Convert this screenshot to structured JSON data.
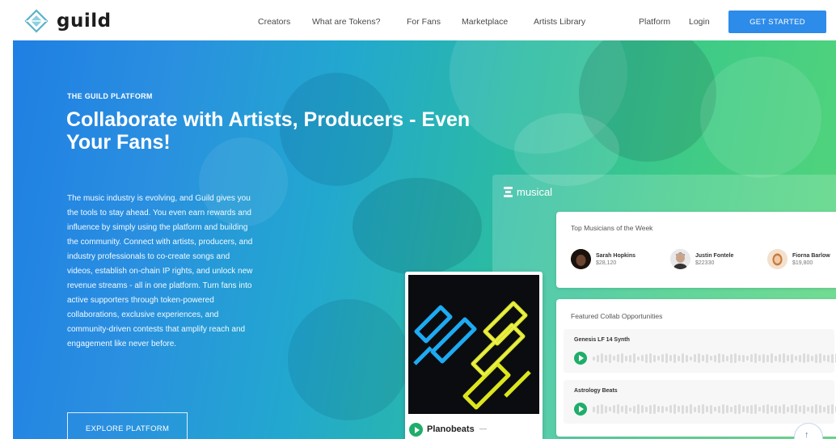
{
  "header": {
    "logo_text": "guild",
    "nav": [
      {
        "label": "Creators"
      },
      {
        "label": "What are Tokens?"
      },
      {
        "label": "For Fans"
      },
      {
        "label": "Marketplace"
      },
      {
        "label": "Artists Library"
      },
      {
        "label": "Platform"
      },
      {
        "label": "Login"
      }
    ],
    "cta_label": "GET STARTED"
  },
  "hero": {
    "eyebrow": "THE GUILD PLATFORM",
    "headline": "Collaborate with Artists, Producers - Even Your Fans!",
    "description": "The music industry is evolving, and Guild gives you the tools to stay ahead. You even earn rewards and influence by simply using the platform and building the community. Connect with artists, producers, and industry professionals to co-create songs and videos, establish on-chain IP rights, and unlock new revenue streams - all in one platform. Turn fans into active supporters through token-powered collaborations, exclusive experiences, and community-driven contests that amplify reach and engagement like never before.",
    "explore_label": "EXPLORE PLATFORM"
  },
  "panel": {
    "brand": "musical",
    "top_title": "Top Musicians of the Week",
    "musicians": [
      {
        "name": "Sarah Hopkins",
        "value": "$28,120"
      },
      {
        "name": "Justin Fontele",
        "value": "$22330"
      },
      {
        "name": "Fiorna Barlow",
        "value": "$19,800"
      }
    ],
    "collab_title": "Featured Collab Opportunities",
    "tracks": [
      {
        "name": "Genesis LF 14 Synth"
      },
      {
        "name": "Astrology Beats"
      }
    ]
  },
  "player": {
    "title": "Planobeats",
    "more": "—"
  },
  "colors": {
    "cta": "#2d8bea",
    "play": "#1fae6a"
  }
}
